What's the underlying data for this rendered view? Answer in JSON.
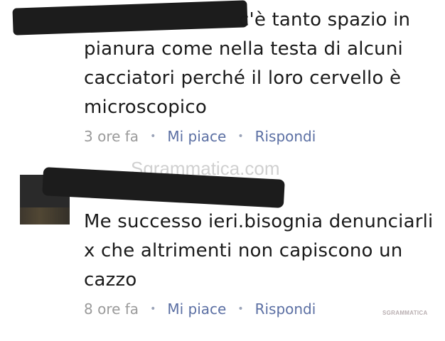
{
  "comments": [
    {
      "text": "c'è tanto spazio in pianura come nella testa di alcuni cacciatori perché il loro cervello è microscopico",
      "time": "3 ore fa",
      "like_label": "Mi piace",
      "reply_label": "Rispondi"
    },
    {
      "text": "Me successo ieri.bisognia denunciarli x che altrimenti non capiscono un cazzo",
      "time": "8 ore fa",
      "like_label": "Mi piace",
      "reply_label": "Rispondi"
    }
  ],
  "meta_separator": "•",
  "watermark": "Sgrammatica.com",
  "logo_text": "SGRAMMATICA"
}
